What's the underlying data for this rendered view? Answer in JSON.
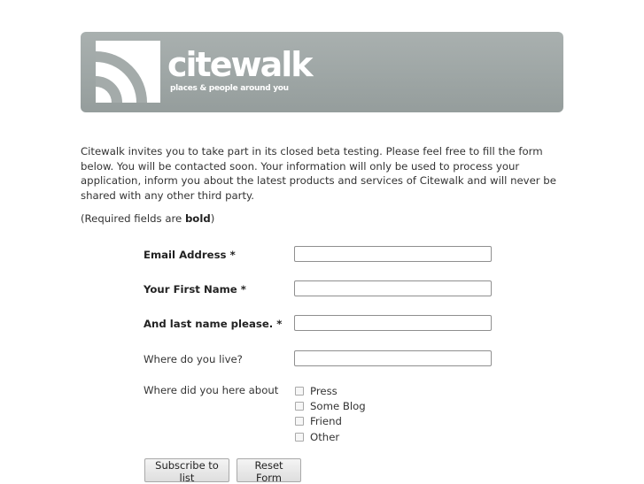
{
  "header": {
    "brand": "citewalk",
    "tagline": "places & people around you"
  },
  "intro": "Citewalk invites you to take part in its closed beta testing. Please feel free to fill the form below. You will be contacted soon. Your information will only be used to process your application, inform you about the latest products and services of Citewalk and will never be shared with any other third party.",
  "required_note": {
    "prefix": "(Required fields are ",
    "bold": "bold",
    "suffix": ")"
  },
  "form": {
    "email_label": "Email Address *",
    "email_value": "",
    "first_name_label": "Your First Name *",
    "first_name_value": "",
    "last_name_label": "And last name please. *",
    "last_name_value": "",
    "location_label": "Where do you live?",
    "location_value": "",
    "source_label": "Where did you here about",
    "source_options": [
      {
        "label": "Press",
        "checked": false
      },
      {
        "label": "Some Blog",
        "checked": false
      },
      {
        "label": "Friend",
        "checked": false
      },
      {
        "label": "Other",
        "checked": false
      }
    ],
    "subscribe_label": "Subscribe to list",
    "reset_label": "Reset Form"
  }
}
